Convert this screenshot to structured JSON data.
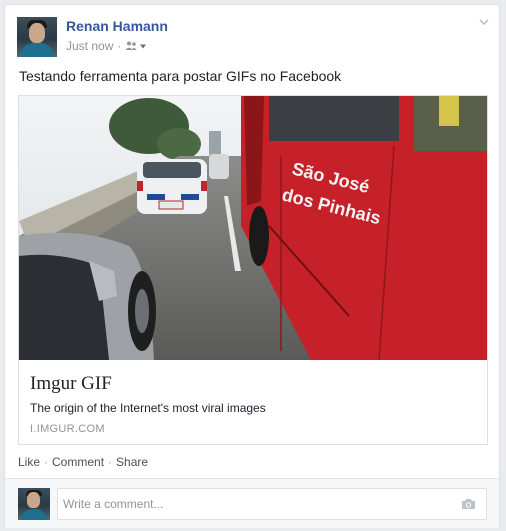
{
  "post": {
    "author": "Renan Hamann",
    "time": "Just now",
    "privacy_icon": "friends-icon",
    "text": "Testando ferramenta para postar GIFs no Facebook"
  },
  "link_preview": {
    "image_text_line1": "São José",
    "image_text_line2": "dos Pinhais",
    "title": "Imgur GIF",
    "description": "The origin of the Internet's most viral images",
    "domain": "I.IMGUR.COM"
  },
  "actions": {
    "like": "Like",
    "comment": "Comment",
    "share": "Share"
  },
  "comment_box": {
    "placeholder": "Write a comment..."
  },
  "colors": {
    "author_link": "#365899",
    "bus_red": "#c62028",
    "muted": "#90949c"
  }
}
